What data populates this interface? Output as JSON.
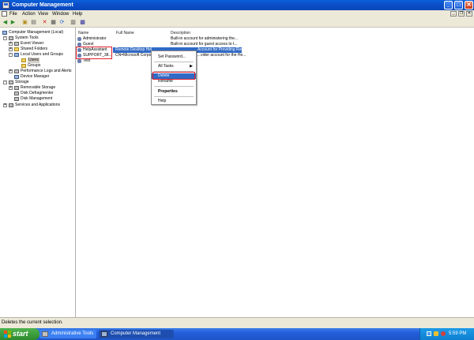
{
  "window": {
    "title": "Computer Management"
  },
  "title_buttons": {
    "minimize": "_",
    "maximize": "□",
    "close": "✕"
  },
  "menu": [
    "File",
    "Action",
    "View",
    "Window",
    "Help"
  ],
  "tree": {
    "root": "Computer Management (Local)",
    "system_tools": "System Tools",
    "event_viewer": "Event Viewer",
    "shared_folders": "Shared Folders",
    "local_users_groups": "Local Users and Groups",
    "users": "Users",
    "groups": "Groups",
    "perf_logs": "Performance Logs and Alerts",
    "device_manager": "Device Manager",
    "storage": "Storage",
    "removable_storage": "Removable Storage",
    "disk_defrag": "Disk Defragmenter",
    "disk_mgmt": "Disk Management",
    "services_apps": "Services and Applications"
  },
  "columns": {
    "name": "Name",
    "full_name": "Full Name",
    "description": "Description"
  },
  "users": [
    {
      "name": "Administrator",
      "full_name": "",
      "description": "Built-in account for administering the..."
    },
    {
      "name": "Guest",
      "full_name": "",
      "description": "Built-in account for guest access to t..."
    },
    {
      "name": "HelpAssistant",
      "full_name": "Remote Desktop Hel",
      "description": "Account for Providing Remote Assist..."
    },
    {
      "name": "SUPPORT_38...",
      "full_name": "CN=Microsoft Corpo",
      "description": "...vider account for the He..."
    },
    {
      "name": "Test",
      "full_name": "",
      "description": ""
    }
  ],
  "context_menu": {
    "set_password": "Set Password...",
    "all_tasks": "All Tasks",
    "delete": "Delete",
    "rename": "Rename",
    "properties": "Properties",
    "help": "Help"
  },
  "status": {
    "text": "Deletes the current selection."
  },
  "taskbar": {
    "start": "start",
    "tasks": [
      "Administrative Tools",
      "Computer Management"
    ],
    "clock": "5:59 PM"
  },
  "colors": {
    "titlebar": "#0b4fca",
    "highlight": "#316ac5",
    "annotation": "#e0202a",
    "taskbar": "#245edb",
    "start": "#3a9a3a"
  }
}
